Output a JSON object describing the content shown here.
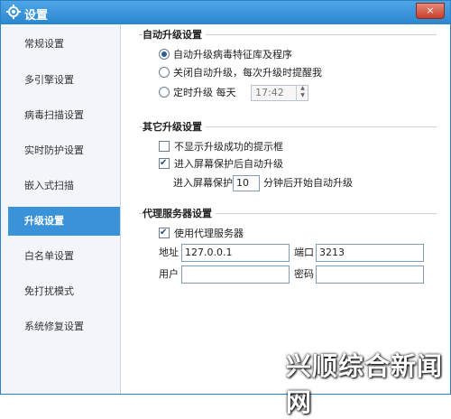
{
  "window": {
    "title": "设置",
    "close_label": "×"
  },
  "sidebar": {
    "items": [
      {
        "label": "常规设置"
      },
      {
        "label": "多引擎设置"
      },
      {
        "label": "病毒扫描设置"
      },
      {
        "label": "实时防护设置"
      },
      {
        "label": "嵌入式扫描"
      },
      {
        "label": "升级设置",
        "active": true
      },
      {
        "label": "白名单设置"
      },
      {
        "label": "免打扰模式"
      },
      {
        "label": "系统修复设置"
      }
    ]
  },
  "auto_upgrade": {
    "title": "自动升级设置",
    "option1": "自动升级病毒特征库及程序",
    "option2": "关闭自动升级，每次升级时提醒我",
    "option3": "定时升级 每天",
    "selected": "option1",
    "time_value": "17:42"
  },
  "other_upgrade": {
    "title": "其它升级设置",
    "hide_tip_label": "不显示升级成功的提示框",
    "hide_tip_checked": false,
    "screensaver_label": "进入屏幕保护后自动升级",
    "screensaver_checked": true,
    "delay_prefix": "进入屏幕保护",
    "delay_minutes": "10",
    "delay_suffix": "分钟后开始自动升级"
  },
  "proxy": {
    "title": "代理服务器设置",
    "use_proxy_label": "使用代理服务器",
    "use_proxy_checked": true,
    "address_label": "地址",
    "address_value": "127.0.0.1",
    "port_label": "端口",
    "port_value": "3213",
    "user_label": "用户",
    "user_value": "",
    "password_label": "密码",
    "password_value": ""
  },
  "watermark": {
    "text": "兴顺综合新闻网"
  },
  "colors": {
    "title_bar": "#2b86cf",
    "sidebar_active": "#3a93d8",
    "sidebar_bg": "#f2f6fa"
  }
}
